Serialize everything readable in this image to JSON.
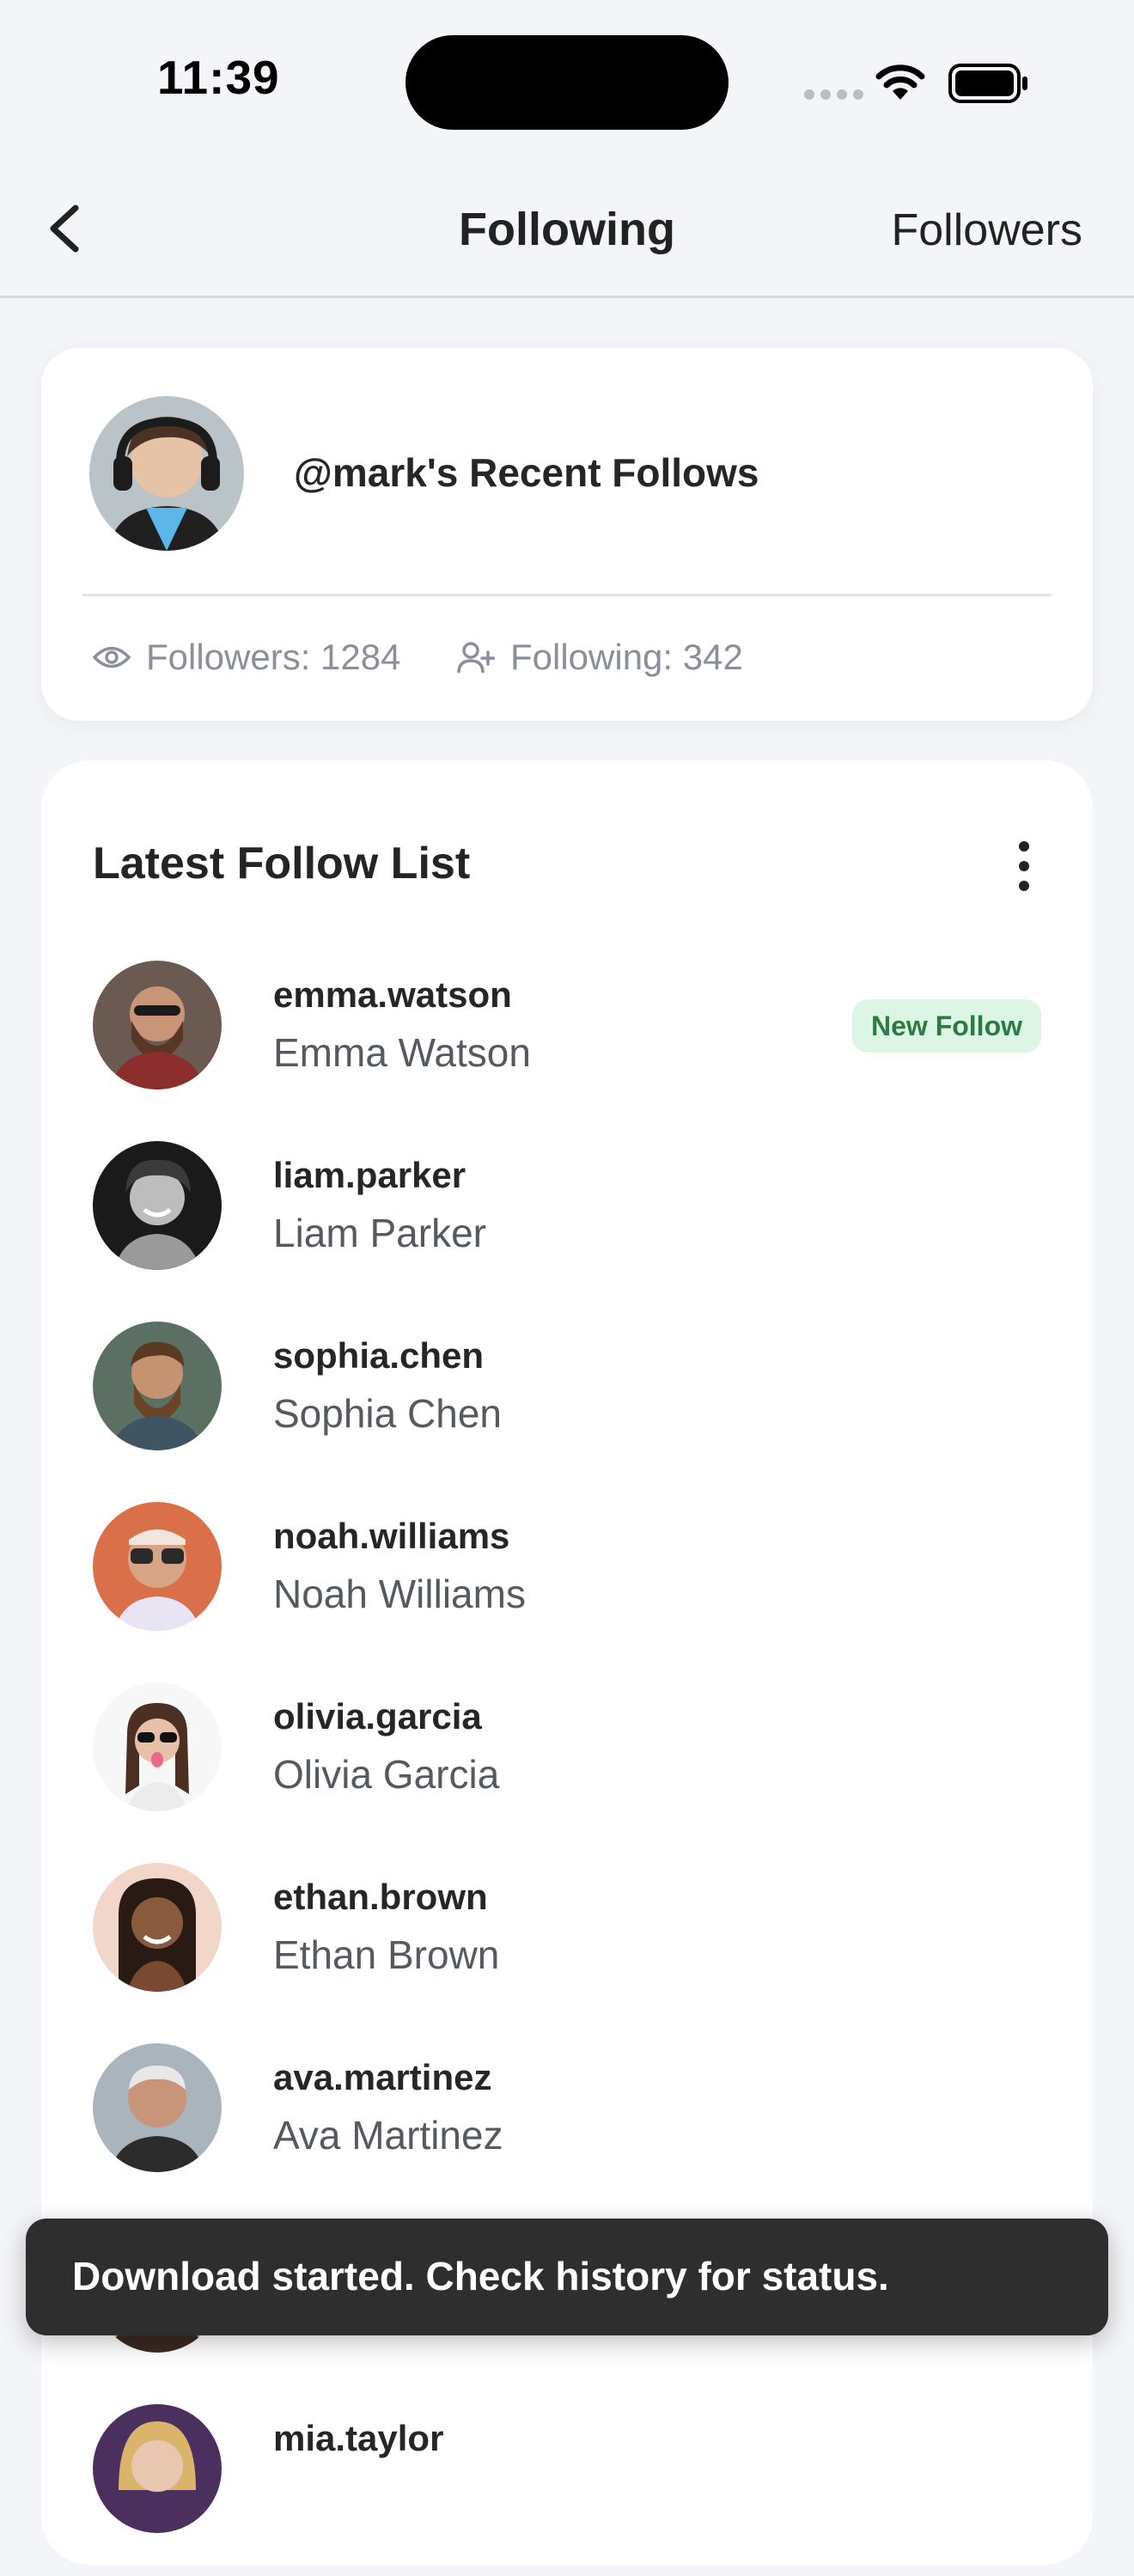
{
  "status_bar": {
    "time": "11:39"
  },
  "nav": {
    "title": "Following",
    "right_link": "Followers"
  },
  "profile": {
    "title": "@mark's Recent Follows",
    "followers": "Followers: 1284",
    "following": "Following: 342"
  },
  "list": {
    "title": "Latest Follow List",
    "items": [
      {
        "username": "emma.watson",
        "name": "Emma Watson",
        "badge": "New Follow"
      },
      {
        "username": "liam.parker",
        "name": "Liam Parker"
      },
      {
        "username": "sophia.chen",
        "name": "Sophia Chen"
      },
      {
        "username": "noah.williams",
        "name": "Noah Williams"
      },
      {
        "username": "olivia.garcia",
        "name": "Olivia Garcia"
      },
      {
        "username": "ethan.brown",
        "name": "Ethan Brown"
      },
      {
        "username": "ava.martinez",
        "name": "Ava Martinez"
      },
      {
        "username": "",
        "name": ""
      },
      {
        "username": "mia.taylor",
        "name": ""
      }
    ]
  },
  "toast": {
    "message": "Download started. Check history for status."
  },
  "colors": {
    "badge_bg": "#dcf5e4",
    "badge_text": "#2d7a44",
    "toast_bg": "#2e2e2e"
  }
}
